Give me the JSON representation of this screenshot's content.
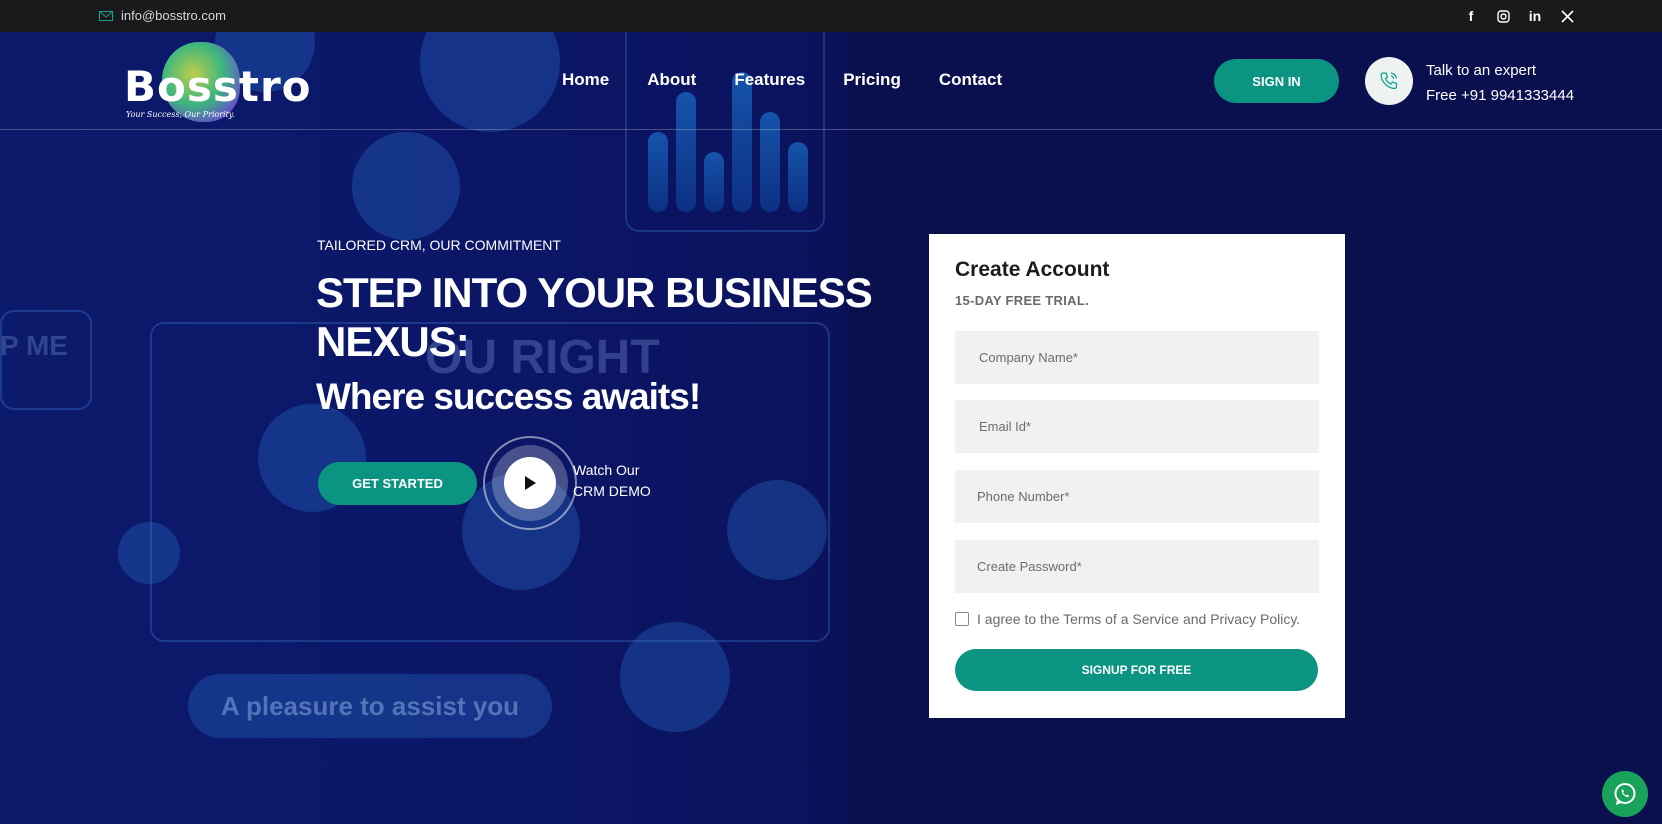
{
  "topbar": {
    "email": "info@bosstro.com",
    "social_icons": [
      "facebook-icon",
      "instagram-icon",
      "linkedin-icon",
      "x-icon"
    ]
  },
  "brand": {
    "name": "Bosstro",
    "tagline": "Your Success, Our Priority."
  },
  "nav": {
    "items": [
      "Home",
      "About",
      "Features",
      "Pricing",
      "Contact"
    ]
  },
  "header": {
    "signin_label": "SIGN IN",
    "expert_label": "Talk to an expert",
    "phone": "Free +91 9941333444"
  },
  "hero": {
    "eyebrow": "TAILORED CRM, OUR COMMITMENT",
    "headline": "STEP INTO YOUR BUSINESS NEXUS:",
    "subheadline": "Where success awaits!",
    "cta_label": "GET STARTED",
    "demo_line1": "Watch Our",
    "demo_line2": "CRM DEMO",
    "bg_text_1": "P ME",
    "bg_text_2": "OU RIGHT",
    "bg_text_3": "A pleasure to assist you"
  },
  "form": {
    "title": "Create Account",
    "subtitle": "15-DAY FREE TRIAL.",
    "company_placeholder": "Company Name*",
    "email_placeholder": "Email Id*",
    "phone_placeholder": "Phone Number*",
    "password_placeholder": "Create Password*",
    "agree_text": "I agree to the Terms of a Service and Privacy Policy.",
    "submit_label": "SIGNUP FOR FREE"
  },
  "colors": {
    "accent": "#0b9482",
    "topbar": "#1a1a1d",
    "hero_bg": "#0a0f4e",
    "whatsapp": "#19a35a"
  }
}
